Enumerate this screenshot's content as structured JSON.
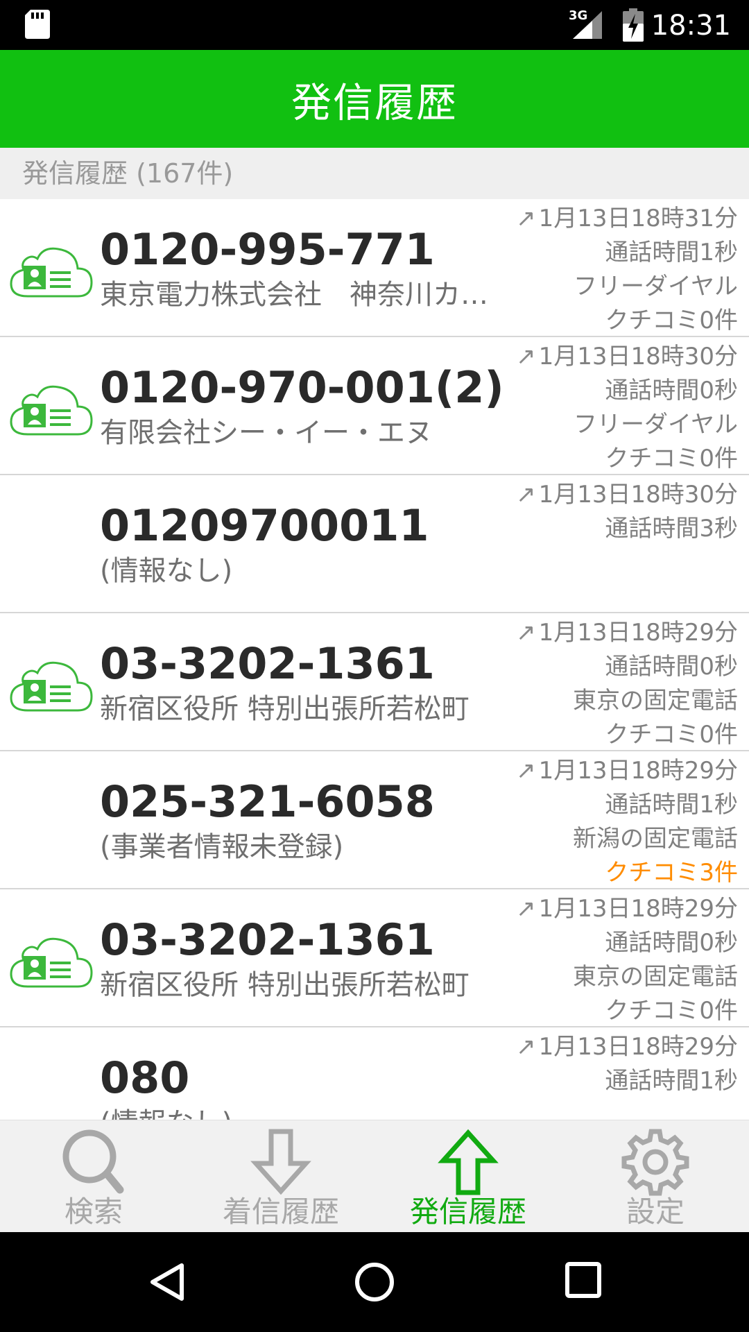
{
  "status_bar": {
    "network": "3G",
    "time": "18:31"
  },
  "app_bar": {
    "title": "発信履歴"
  },
  "section_header": "発信履歴 (167件)",
  "calls": [
    {
      "number": "0120-995-771",
      "name": "東京電力株式会社　神奈川カ…",
      "has_cloud_icon": true,
      "datetime": "1月13日18時31分",
      "duration": "通話時間1秒",
      "line_type": "フリーダイヤル",
      "kuchikomi": "クチコミ0件"
    },
    {
      "number": "0120-970-001(2)",
      "name": "有限会社シー・イー・エヌ",
      "has_cloud_icon": true,
      "datetime": "1月13日18時30分",
      "duration": "通話時間0秒",
      "line_type": "フリーダイヤル",
      "kuchikomi": "クチコミ0件"
    },
    {
      "number": "01209700011",
      "name": "(情報なし)",
      "has_cloud_icon": false,
      "datetime": "1月13日18時30分",
      "duration": "通話時間3秒",
      "line_type": "",
      "kuchikomi": ""
    },
    {
      "number": "03-3202-1361",
      "name": "新宿区役所 特別出張所若松町",
      "has_cloud_icon": true,
      "datetime": "1月13日18時29分",
      "duration": "通話時間0秒",
      "line_type": "東京の固定電話",
      "kuchikomi": "クチコミ0件"
    },
    {
      "number": "025-321-6058",
      "name": "(事業者情報未登録)",
      "has_cloud_icon": false,
      "datetime": "1月13日18時29分",
      "duration": "通話時間1秒",
      "line_type": "新潟の固定電話",
      "kuchikomi": "クチコミ3件",
      "kuchikomi_highlight": true
    },
    {
      "number": "03-3202-1361",
      "name": "新宿区役所 特別出張所若松町",
      "has_cloud_icon": true,
      "datetime": "1月13日18時29分",
      "duration": "通話時間0秒",
      "line_type": "東京の固定電話",
      "kuchikomi": "クチコミ0件"
    },
    {
      "number": "080",
      "name": "(情報なし)",
      "has_cloud_icon": false,
      "datetime": "1月13日18時29分",
      "duration": "通話時間1秒",
      "line_type": "",
      "kuchikomi": ""
    }
  ],
  "outgoing_arrow": "↗",
  "bottom_nav": [
    {
      "label": "検索",
      "icon": "search-icon",
      "active": false
    },
    {
      "label": "着信履歴",
      "icon": "arrow-down-icon",
      "active": false
    },
    {
      "label": "発信履歴",
      "icon": "arrow-up-icon",
      "active": true
    },
    {
      "label": "設定",
      "icon": "gear-icon",
      "active": false
    }
  ],
  "colors": {
    "brand_green": "#11c011",
    "active_tab": "#11aa11",
    "highlight_orange": "#ff8c00"
  }
}
